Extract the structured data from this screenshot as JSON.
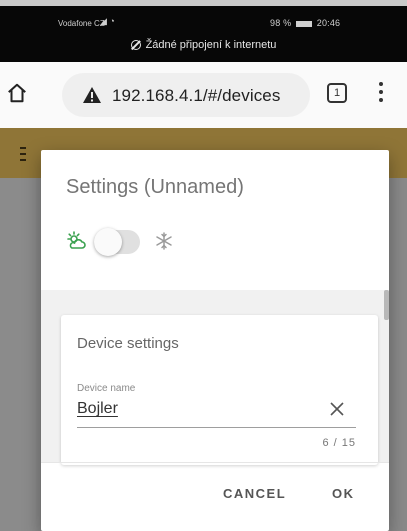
{
  "status_bar": {
    "carrier": "Vodafone CZ",
    "right_status": "98 %",
    "time": "20:46",
    "no_connection": "Žádné připojení k internetu"
  },
  "browser": {
    "url": "192.168.4.1/#/devices",
    "tab_count": "1",
    "icons": [
      "home-icon",
      "not-secure-warning-icon",
      "tabs-icon",
      "more-menu-icon"
    ]
  },
  "dialog": {
    "title": "Settings (Unnamed)",
    "mode_toggle": {
      "left_icon": "sun-cloud-icon",
      "right_icon": "snowflake-icon",
      "on": false
    },
    "card": {
      "title": "Device settings",
      "field_label": "Device name",
      "field_value": "Bojler",
      "counter": "6 / 15"
    },
    "actions": {
      "cancel": "CANCEL",
      "ok": "OK"
    }
  },
  "colors": {
    "app_bar": "#8f7537",
    "toggle_icon_green": "#3aa14f"
  }
}
